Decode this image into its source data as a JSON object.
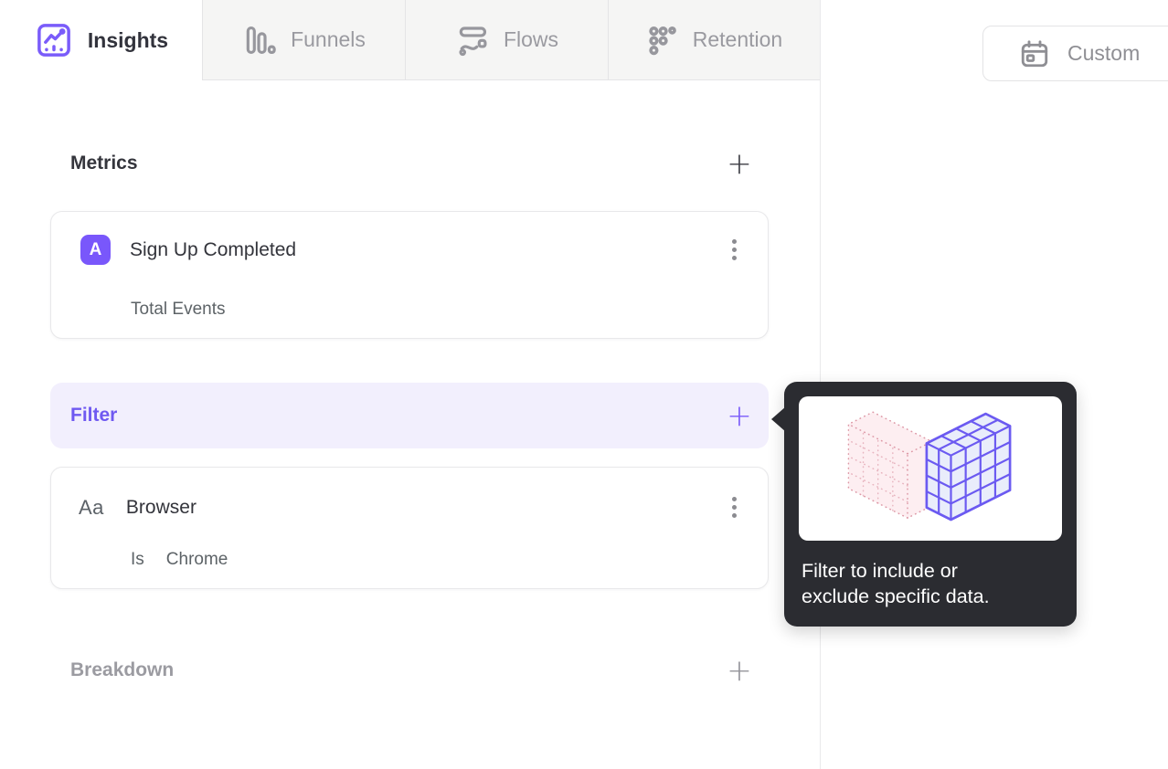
{
  "tabs": [
    {
      "label": "Insights",
      "active": true
    },
    {
      "label": "Funnels",
      "active": false
    },
    {
      "label": "Flows",
      "active": false
    },
    {
      "label": "Retention",
      "active": false
    }
  ],
  "date_picker": {
    "label": "Custom"
  },
  "builder": {
    "metrics_section": {
      "title": "Metrics"
    },
    "metric_card": {
      "badge": "A",
      "title": "Sign Up Completed",
      "subtitle": "Total Events"
    },
    "filter_section": {
      "title": "Filter"
    },
    "filter_card": {
      "icon_text": "Aa",
      "title": "Browser",
      "operator": "Is",
      "value": "Chrome"
    },
    "breakdown_section": {
      "title": "Breakdown"
    }
  },
  "tooltip": {
    "lines": [
      "Filter to include or",
      "exclude specific data."
    ]
  },
  "icons": {
    "plus": "+",
    "insights": "line-chart-icon",
    "funnels": "bar-chart-icon",
    "flows": "flow-wave-icon",
    "retention": "dot-grid-icon",
    "custom": "calendar-icon",
    "kebab": "vertical-dots-icon"
  },
  "colors": {
    "accent": "#7856ff",
    "filter_bg": "#f2effd",
    "tooltip_bg": "#2b2c31",
    "inactive_tab_text": "#9a9aa0",
    "card_border": "#e8e8ea",
    "pink": "#dc93a2"
  }
}
